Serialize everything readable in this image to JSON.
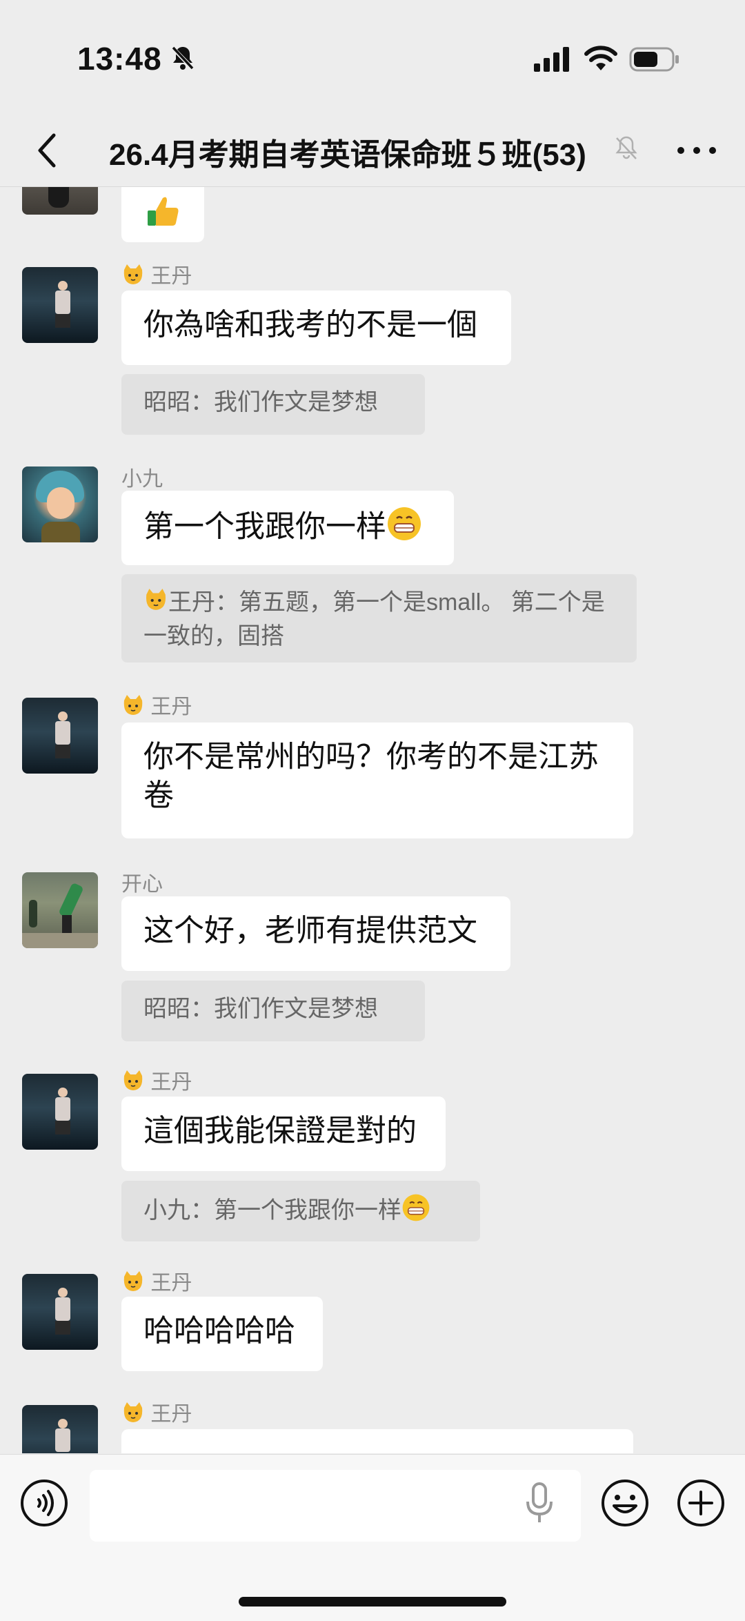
{
  "status_bar": {
    "time": "13:48"
  },
  "header": {
    "title": "26.4月考期自考英语保命班５班(53)"
  },
  "messages": [
    {
      "sender": "王丹",
      "text": "你為啥和我考的不是一個",
      "quote": "昭昭：我们作文是梦想"
    },
    {
      "sender": "小九",
      "text": "第一个我跟你一样",
      "quote_sender": "王丹",
      "quote": "：第五题，第一个是small。 第二个是一致的，固搭"
    },
    {
      "sender": "王丹",
      "text_line1": "你不是常州的吗？你考的不是江苏",
      "text_line2": "卷"
    },
    {
      "sender": "开心",
      "text": "这个好，老师有提供范文",
      "quote": "昭昭：我们作文是梦想"
    },
    {
      "sender": "王丹",
      "text": "這個我能保證是對的",
      "quote": "小九：第一个我跟你一样"
    },
    {
      "sender": "王丹",
      "text": "哈哈哈哈哈"
    },
    {
      "sender": "王丹"
    }
  ],
  "input_bar": {
    "placeholder": ""
  },
  "colors": {
    "background": "#ededed",
    "bubble": "#ffffff",
    "quote": "#e1e1e1",
    "name": "#8a8a8a"
  }
}
